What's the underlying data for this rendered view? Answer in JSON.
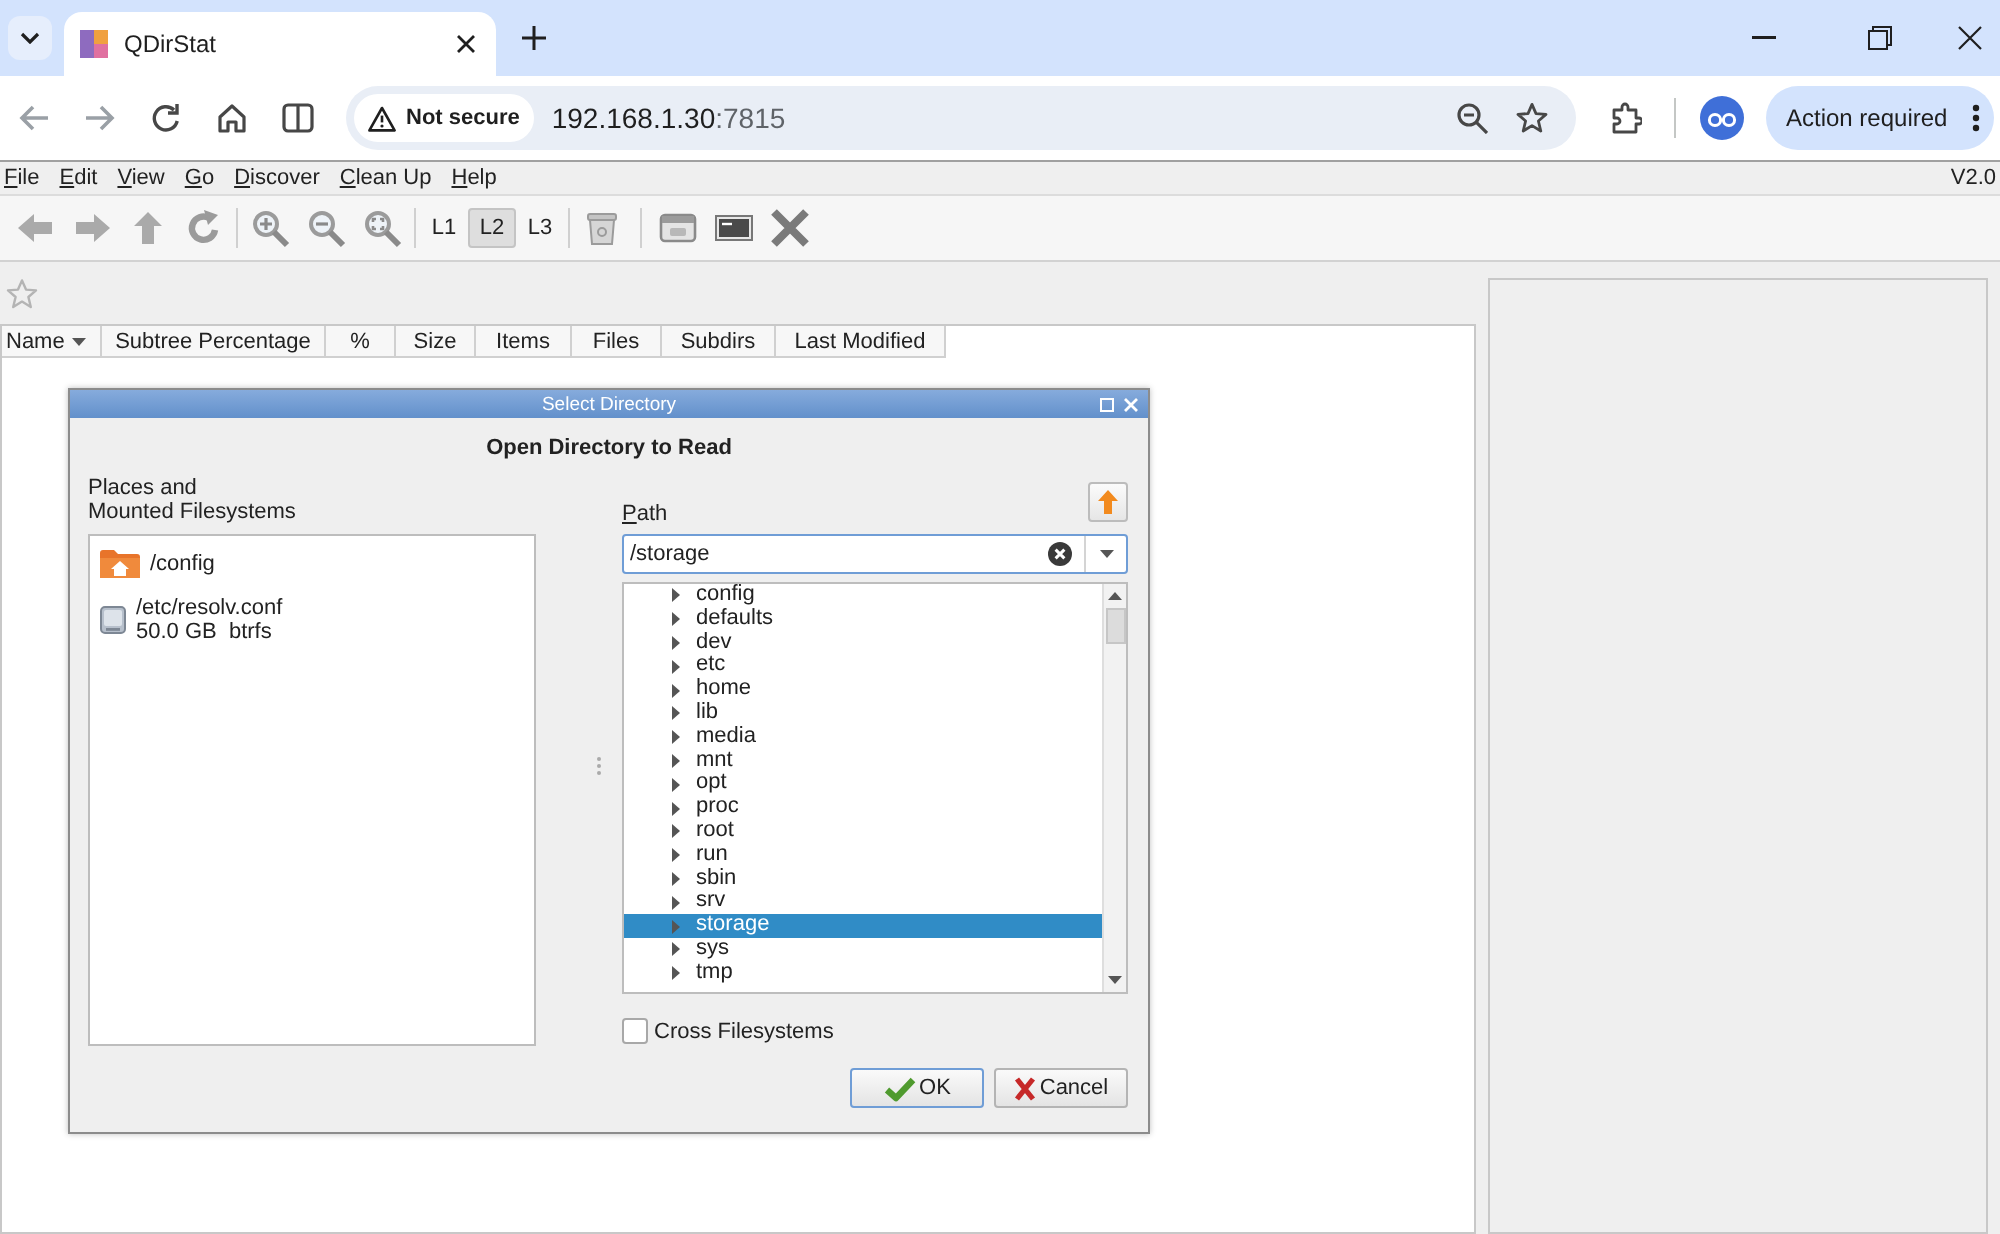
{
  "browser": {
    "tabs": [
      {
        "title": "QDirStat",
        "selected": true
      }
    ],
    "address_bar": {
      "security_label": "Not secure",
      "host": "192.168.1.30",
      "port": ":7815"
    },
    "profile_button": "Action required"
  },
  "menu_bar": {
    "items": [
      "File",
      "Edit",
      "View",
      "Go",
      "Discover",
      "Clean Up",
      "Help"
    ],
    "version": "V2.0"
  },
  "toolbar": {
    "level_buttons": [
      {
        "label": "L1",
        "selected": false
      },
      {
        "label": "L2",
        "selected": true
      },
      {
        "label": "L3",
        "selected": false
      }
    ]
  },
  "tree_view": {
    "columns": [
      "Name",
      "Subtree Percentage",
      "%",
      "Size",
      "Items",
      "Files",
      "Subdirs",
      "Last Modified"
    ]
  },
  "dialog": {
    "title": "Select Directory",
    "heading": "Open Directory to Read",
    "places_label": "Places and\nMounted Filesystems",
    "places": [
      {
        "kind": "folder",
        "path": "/config"
      },
      {
        "kind": "disk",
        "path": "/etc/resolv.conf",
        "detail": "50.0 GB  btrfs"
      }
    ],
    "path_label": "Path",
    "path_value": "/storage",
    "directories": [
      {
        "name": "config",
        "expanded": false,
        "selected": false
      },
      {
        "name": "defaults",
        "expanded": false,
        "selected": false
      },
      {
        "name": "dev",
        "expanded": false,
        "selected": false
      },
      {
        "name": "etc",
        "expanded": false,
        "selected": false
      },
      {
        "name": "home",
        "expanded": false,
        "selected": false
      },
      {
        "name": "lib",
        "expanded": false,
        "selected": false
      },
      {
        "name": "media",
        "expanded": false,
        "selected": false
      },
      {
        "name": "mnt",
        "expanded": false,
        "selected": false
      },
      {
        "name": "opt",
        "expanded": false,
        "selected": false
      },
      {
        "name": "proc",
        "expanded": false,
        "selected": false
      },
      {
        "name": "root",
        "expanded": false,
        "selected": false
      },
      {
        "name": "run",
        "expanded": false,
        "selected": false
      },
      {
        "name": "sbin",
        "expanded": false,
        "selected": false
      },
      {
        "name": "srv",
        "expanded": false,
        "selected": false
      },
      {
        "name": "storage",
        "expanded": false,
        "selected": true
      },
      {
        "name": "sys",
        "expanded": false,
        "selected": false
      },
      {
        "name": "tmp",
        "expanded": false,
        "selected": false
      }
    ],
    "cross_filesystems": {
      "label": "Cross Filesystems",
      "checked": false
    },
    "buttons": [
      {
        "kind": "ok",
        "label": "OK"
      },
      {
        "kind": "cancel",
        "label": "Cancel"
      }
    ]
  }
}
